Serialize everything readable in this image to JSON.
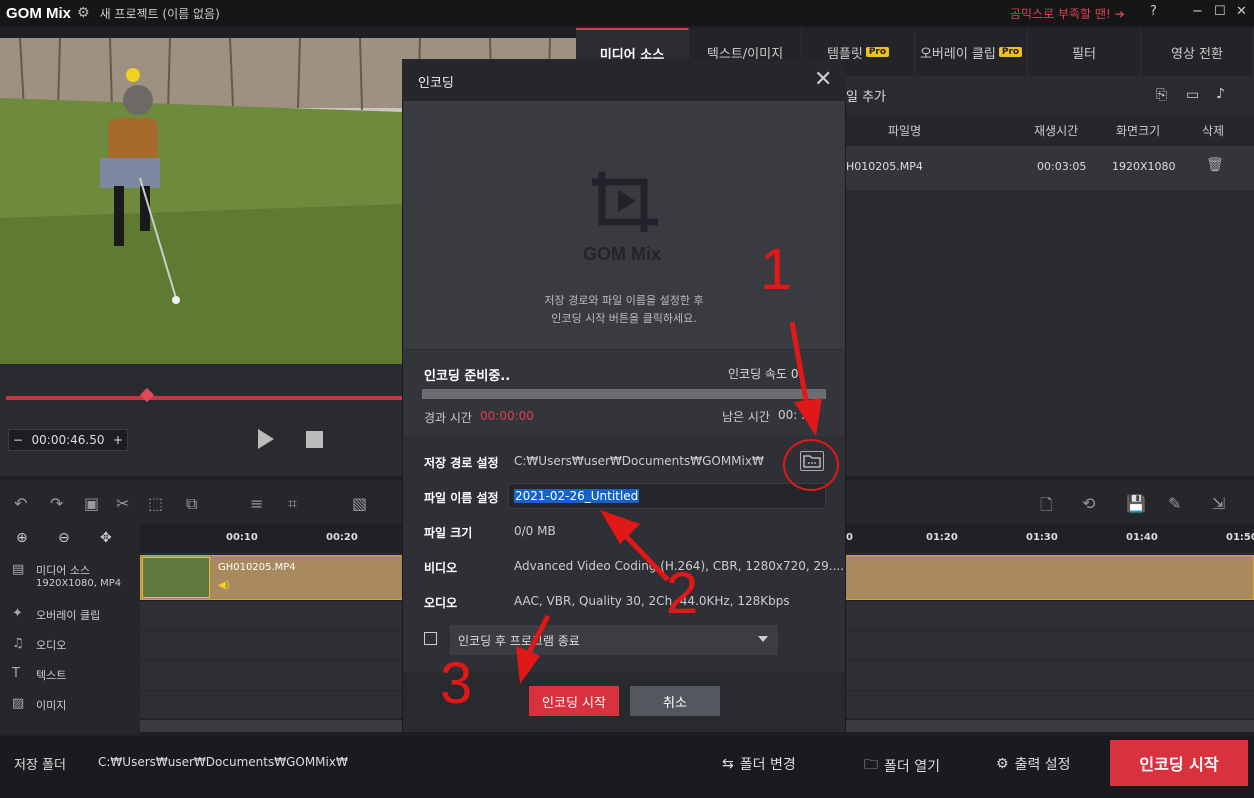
{
  "app": {
    "name": "GOM Mix",
    "project_title": "새 프로젝트 (이름 없음)",
    "promo": "곰믹스로 부족할 땐! ➔",
    "help": "?"
  },
  "player": {
    "timecode": "00:00:46.50",
    "minus": "−",
    "plus": "+"
  },
  "tabs": [
    {
      "label": "미디어 소스",
      "pro": ""
    },
    {
      "label": "텍스트/이미지",
      "pro": ""
    },
    {
      "label": "템플릿",
      "pro": "Pro"
    },
    {
      "label": "오버레이 클립",
      "pro": "Pro"
    },
    {
      "label": "필터",
      "pro": ""
    },
    {
      "label": "영상 전환",
      "pro": ""
    }
  ],
  "media": {
    "add_file": "일 추가",
    "columns": [
      "파일명",
      "재생시간",
      "화면크기",
      "삭제"
    ],
    "rows": [
      {
        "name": "H010205.MP4",
        "duration": "00:03:05",
        "size": "1920X1080"
      }
    ]
  },
  "timeline": {
    "ticks": [
      "00:10",
      "00:20",
      "0",
      "01:20",
      "01:30",
      "01:40",
      "01:50"
    ],
    "tracks": [
      "미디어 소스",
      "오버레이 클립",
      "오디오",
      "텍스트",
      "이미지"
    ],
    "media_sub": "1920X1080, MP4",
    "clip_name": "GH010205.MP4"
  },
  "bottom": {
    "save_folder_label": "저장 폴더",
    "save_folder_path": "C:₩Users₩user₩Documents₩GOMMix₩",
    "change_folder": "폴더 변경",
    "open_folder": "폴더 열기",
    "output_settings": "출력 설정",
    "encode_start": "인코딩 시작"
  },
  "dialog": {
    "title": "인코딩",
    "logo_text": "GOM Mix",
    "hint_line1": "저장 경로와 파일 이름을 설정한 후",
    "hint_line2": "인코딩 시작 버튼을 클릭하세요.",
    "status": "인코딩 준비중..",
    "speed": "인코딩 속도 0",
    "elapsed_label": "경과 시간",
    "elapsed_value": "00:00:00",
    "remain_label": "남은 시간",
    "remain_value": "00:  :  0",
    "progress": 0,
    "path_label": "저장 경로 설정",
    "path_value": "C:₩Users₩user₩Documents₩GOMMix₩",
    "filename_label": "파일 이름 설정",
    "filename_value": "2021-02-26_Untitled",
    "size_label": "파일 크기",
    "size_value": "0/0 MB",
    "video_label": "비디오",
    "video_value": "Advanced Video Coding (H.264), CBR, 1280x720, 29....",
    "audio_label": "오디오",
    "audio_value": "AAC, VBR, Quality 30, 2Ch, 44.0KHz, 128Kbps",
    "after_option": "인코딩 후 프로그램 종료",
    "encode_button": "인코딩 시작",
    "cancel_button": "취소"
  },
  "annotations": [
    "1",
    "2",
    "3"
  ]
}
